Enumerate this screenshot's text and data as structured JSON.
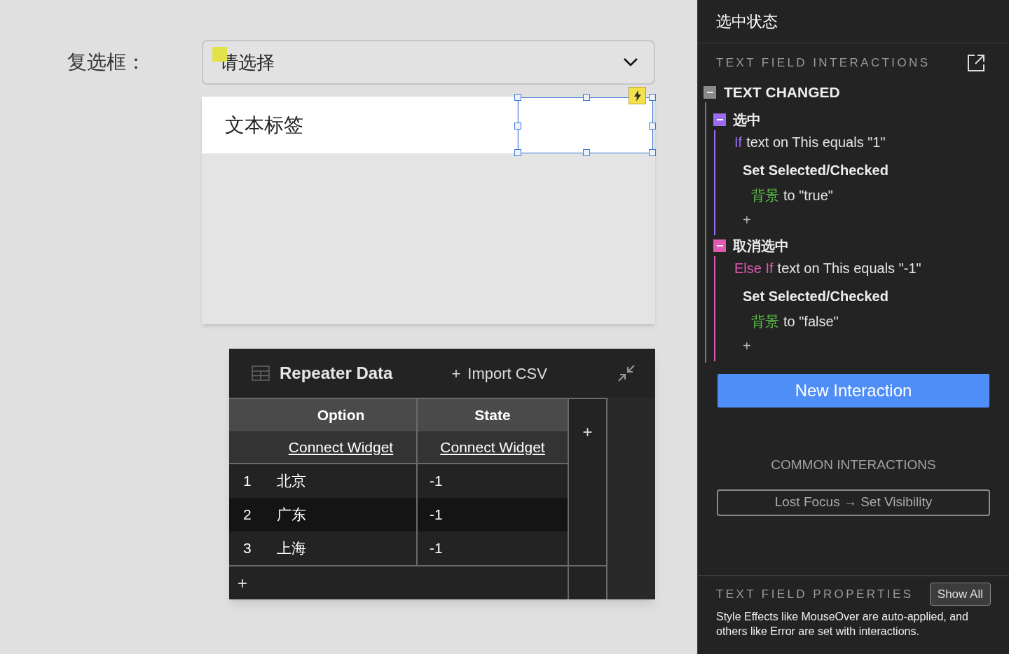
{
  "canvas": {
    "label": "复选框：",
    "dropdown": {
      "value": "请选择"
    },
    "list_item": {
      "label": "文本标签"
    },
    "text_field": {
      "selected": true
    }
  },
  "repeater": {
    "title": "Repeater Data",
    "import_icon": "+",
    "import_label": "Import CSV",
    "columns": [
      {
        "name": "Option",
        "link": "Connect Widget"
      },
      {
        "name": "State",
        "link": "Connect Widget"
      }
    ],
    "add_column": "+",
    "rows": [
      {
        "index": "1",
        "option": "北京",
        "state": "-1",
        "selected": false
      },
      {
        "index": "2",
        "option": "广东",
        "state": "-1",
        "selected": true
      },
      {
        "index": "3",
        "option": "上海",
        "state": "-1",
        "selected": false
      }
    ],
    "add_row": "+"
  },
  "panel": {
    "title": "选中状态",
    "interactions_heading": "TEXT FIELD INTERACTIONS",
    "event": {
      "name": "TEXT CHANGED",
      "expanded": true,
      "cases": [
        {
          "name": "选中",
          "color": "#9b6cf0",
          "keyword": "If",
          "condition": "text on This equals \"1\"",
          "actions": [
            {
              "action": "Set Selected/Checked",
              "target": "背景",
              "value": "to \"true\""
            }
          ],
          "add": "+"
        },
        {
          "name": "取消选中",
          "color": "#e05ab4",
          "keyword": "Else If",
          "condition": "text on This equals \"-1\"",
          "actions": [
            {
              "action": "Set Selected/Checked",
              "target": "背景",
              "value": "to \"false\""
            }
          ],
          "add": "+"
        }
      ]
    },
    "new_interaction": "New Interaction",
    "common_heading": "COMMON INTERACTIONS",
    "common_items": [
      "Lost Focus → Set Visibility"
    ],
    "properties_heading": "TEXT FIELD PROPERTIES",
    "show_all": "Show All",
    "description": "Style Effects like MouseOver are auto-applied, and others like Error are set with interactions."
  }
}
